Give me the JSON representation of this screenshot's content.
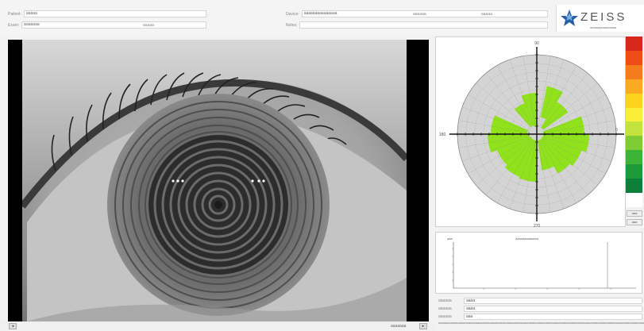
{
  "header": {
    "patient_label": "Patient:",
    "patient_value": "aaaaa",
    "exam_label": "Exam:",
    "exam_value": "aaaaaaa",
    "exam_extra": "aaaaa",
    "device_label": "Device:",
    "device_value": "aaaaaaaaaaaaaaa",
    "date_text": "aaaaaa",
    "time_text": "aaaaa",
    "comment_label": "Notes:",
    "comment_value": ""
  },
  "logo": {
    "brand": "ZEISS",
    "tagline": "aaaaaaaaaaaaaaa"
  },
  "toolbar": {
    "left_btn": "◂",
    "right_text": "aaaaaaa",
    "right_btn": "▸"
  },
  "map": {
    "axis_top": "90",
    "axis_left": "180",
    "axis_right": "0",
    "axis_bottom": "270",
    "colors": [
      "#d9261c",
      "#ee4d1a",
      "#f57c1d",
      "#fbaa22",
      "#fcd31f",
      "#f7ef3a",
      "#c3e23d",
      "#7fcc36",
      "#3cb435",
      "#1d9b3a",
      "#0d7f3a",
      "#ffffff"
    ],
    "btn1": "aaa",
    "btn2": "aaa"
  },
  "histogram": {
    "title": "aaaaaaaaaaaaa",
    "ylabel": "aaa"
  },
  "results": [
    {
      "label": "aaaaaa",
      "value": "aaaa"
    },
    {
      "label": "aaaaaa",
      "value": "aaaa"
    },
    {
      "label": "aaaaaa",
      "value": "aaa"
    }
  ],
  "note": "aaaaaaaaaaaaaaaaaaaaaaaaaaaaaaaaaaaaaaaaaaaaaaaaaaaaaaaaaaaaaaaaaaaaaaaaaaaaaaaaaaaaaaaaaaaaaaaaaaaaaaaaaaaaaaaaaaaaaaaaaaaaaaaa"
}
